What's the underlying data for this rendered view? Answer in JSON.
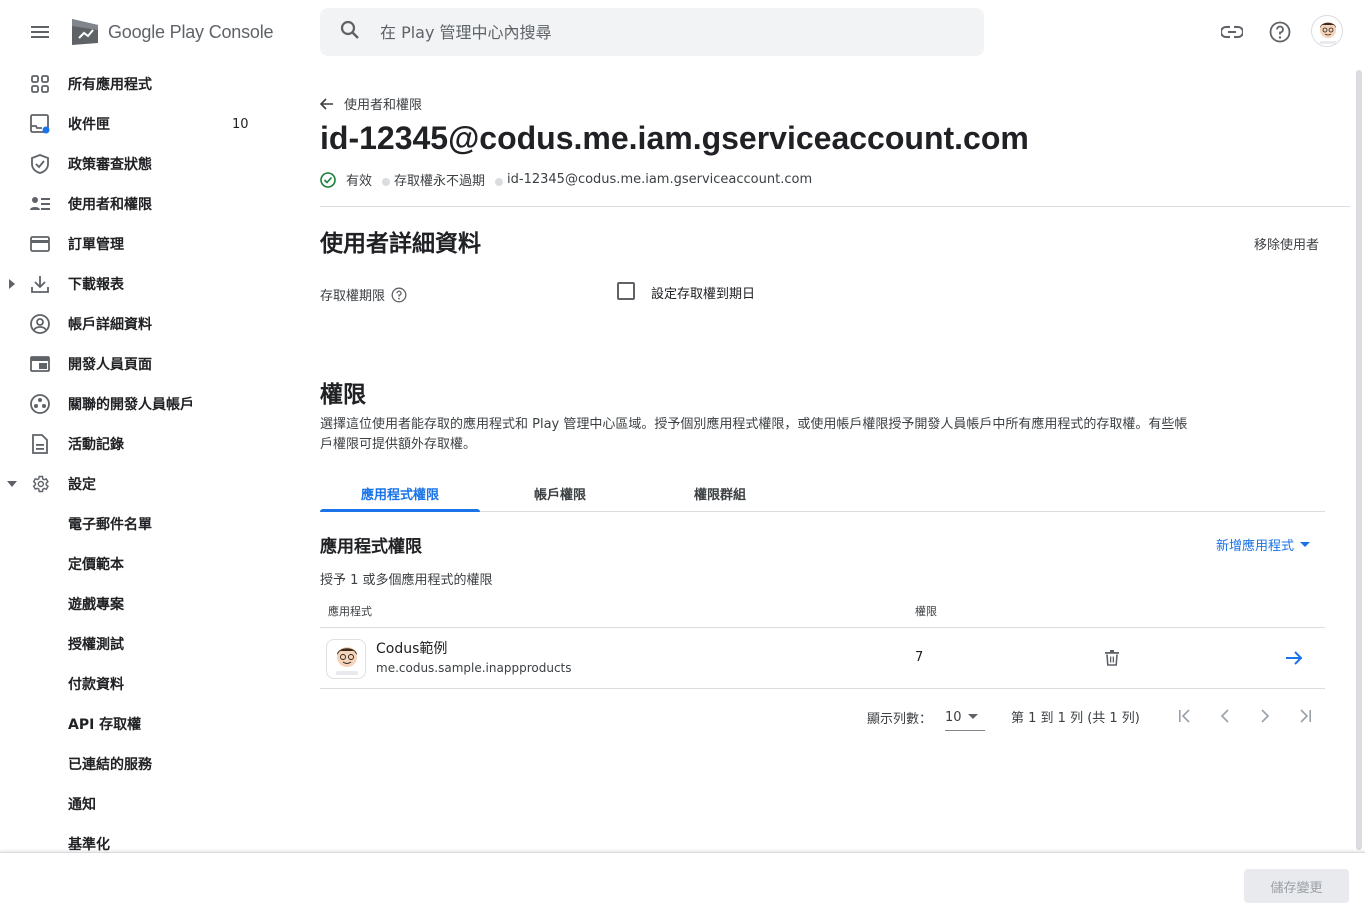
{
  "app": {
    "name_prefix": "Google Play",
    "name_suffix": "Console",
    "brand_color": "#1a73e8"
  },
  "search": {
    "placeholder": "在 Play 管理中心內搜尋",
    "value": ""
  },
  "sidebar": {
    "items": [
      {
        "label": "所有應用程式",
        "icon": "apps-grid-icon"
      },
      {
        "label": "收件匣",
        "icon": "inbox-icon",
        "count": "10"
      },
      {
        "label": "政策審查狀態",
        "icon": "shield-check-icon"
      },
      {
        "label": "使用者和權限",
        "icon": "users-list-icon"
      },
      {
        "label": "訂單管理",
        "icon": "credit-card-icon"
      },
      {
        "label": "下載報表",
        "icon": "download-icon"
      },
      {
        "label": "帳戶詳細資料",
        "icon": "account-circle-icon"
      },
      {
        "label": "開發人員頁面",
        "icon": "web-page-icon"
      },
      {
        "label": "關聯的開發人員帳戶",
        "icon": "linked-accounts-icon"
      },
      {
        "label": "活動記錄",
        "icon": "document-icon"
      },
      {
        "label": "設定",
        "icon": "gear-icon"
      }
    ],
    "settings_sub": [
      "電子郵件名單",
      "定價範本",
      "遊戲專案",
      "授權測試",
      "付款資料",
      "API 存取權",
      "已連結的服務",
      "通知",
      "基準化"
    ]
  },
  "page": {
    "back_label": "使用者和權限",
    "title": "id-12345@codus.me.iam.gserviceaccount.com",
    "status": {
      "active": "有效",
      "access": "存取權永不過期",
      "email": "id-12345@codus.me.iam.gserviceaccount.com"
    },
    "details_heading": "使用者詳細資料",
    "remove_user": "移除使用者",
    "access_expiry_label": "存取權期限",
    "set_expiry_checkbox": "設定存取權到期日",
    "set_expiry_checked": false,
    "permissions_heading": "權限",
    "permissions_desc": "選擇這位使用者能存取的應用程式和 Play 管理中心區域。授予個別應用程式權限，或使用帳戶權限授予開發人員帳戶中所有應用程式的存取權。有些帳戶權限可提供額外存取權。",
    "tabs": [
      {
        "label": "應用程式權限",
        "active": true
      },
      {
        "label": "帳戶權限",
        "active": false
      },
      {
        "label": "權限群組",
        "active": false
      }
    ],
    "app_perm_heading": "應用程式權限",
    "add_app": "新增應用程式",
    "grant_text": "授予 1 或多個應用程式的權限",
    "table": {
      "columns": [
        "應用程式",
        "權限"
      ],
      "rows": [
        {
          "name": "Codus範例",
          "package": "me.codus.sample.inappproducts",
          "permissions": "7"
        }
      ]
    },
    "pagination": {
      "rows_label": "顯示列數：",
      "rows_value": "10",
      "range": "第 1 到 1 列 (共 1 列)"
    }
  },
  "footer": {
    "save_label": "儲存變更"
  }
}
